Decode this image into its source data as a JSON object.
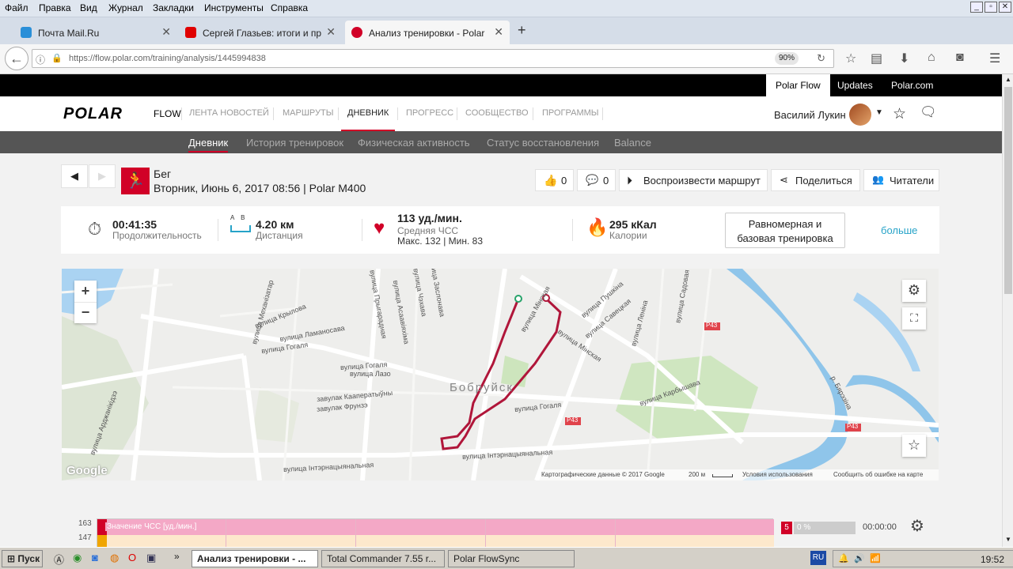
{
  "menubar": {
    "items": [
      "Файл",
      "Правка",
      "Вид",
      "Журнал",
      "Закладки",
      "Инструменты",
      "Справка"
    ]
  },
  "tabs": [
    {
      "title": "Почта Mail.Ru",
      "icon_color": "#2a8fd8"
    },
    {
      "title": "Сергей Глазьев: итоги и пр...",
      "icon_color": "#e00000"
    },
    {
      "title": "Анализ тренировки - Polar F...",
      "icon_color": "#d10027"
    }
  ],
  "nav": {
    "url": "https://flow.polar.com/training/analysis/1445994838",
    "zoom": "90%"
  },
  "topbar": {
    "links": [
      "Polar Flow",
      "Updates",
      "Polar.com"
    ]
  },
  "mainnav": {
    "logo": "POLAR",
    "flow": "FLOW",
    "items": [
      "ЛЕНТА НОВОСТЕЙ",
      "МАРШРУТЫ",
      "ДНЕВНИК",
      "ПРОГРЕСС",
      "СООБЩЕСТВО",
      "ПРОГРАММЫ"
    ],
    "user": "Василий Лукин"
  },
  "subnav": {
    "items": [
      "Дневник",
      "История тренировок",
      "Физическая активность",
      "Статус восстановления",
      "Balance"
    ]
  },
  "training": {
    "sport": "Бег",
    "datetime": "Вторник, Июнь 6, 2017 08:56 | Polar M400",
    "likes": "0",
    "comments": "0",
    "replay": "Воспроизвести маршрут",
    "share": "Поделиться",
    "readers": "Читатели"
  },
  "summary": {
    "duration": "00:41:35",
    "duration_label": "Продолжительность",
    "distance": "4.20 км",
    "distance_label": "Дистанция",
    "distance_ab": "A B",
    "hr": "113 уд./мин.",
    "hr_label": "Средняя ЧСС",
    "hr_minmax": "Макс. 132  |  Мин. 83",
    "calories": "295 кКал",
    "calories_label": "Калории",
    "benefit": "Равномерная и базовая тренировка",
    "more": "больше"
  },
  "map": {
    "city": "Бобруйск",
    "streets": [
      "вулица Крылова",
      "вулица Ламаносава",
      "вулица Гогаля",
      "вулица Лазо",
      "завулак Кааператыўны",
      "завулак Фрунзэ",
      "вулица Інтэрнацыянальная",
      "вулица Пушкіна",
      "вулица Савецкая",
      "вулица Мінская",
      "вулица Леніна",
      "вулица Карбышава",
      "вулица Арджанікідзэ",
      "вулица Механізатар",
      "вулица Прыгарадная",
      "вулица Асаавіяхіма",
      "вулица Чэхава",
      "вулица Заслонава",
      "вулица Садовая"
    ],
    "road_badges": [
      "P43",
      "P43",
      "P43"
    ],
    "river": "р. Бярэзіна",
    "footer": [
      "Картографические данные © 2017 Google",
      "200 м",
      "Условия использования",
      "Сообщить об ошибке на карте"
    ],
    "google": "Google"
  },
  "hrchart": {
    "top_value": "163",
    "second_value": "147",
    "label": "Значение ЧСС [уд./мин.]",
    "zone": "5",
    "zone_pct": "0 %",
    "zone_time": "00:00:00"
  },
  "taskbar": {
    "start": "Пуск",
    "items": [
      "Анализ тренировки - ...",
      "Total Commander 7.55 r...",
      "Polar FlowSync"
    ],
    "lang": "RU",
    "clock": "19:52"
  }
}
